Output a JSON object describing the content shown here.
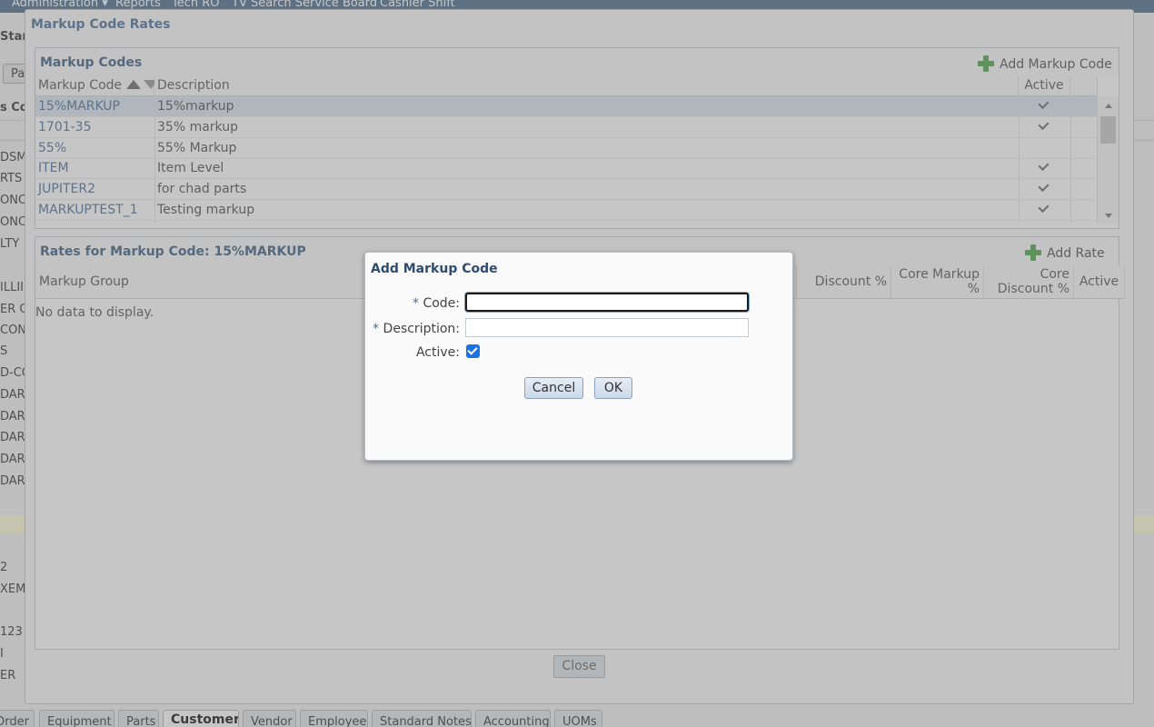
{
  "top_nav": [
    {
      "label": "Administration ▾"
    },
    {
      "label": "Reports"
    },
    {
      "label": "Tech RO"
    },
    {
      "label": "TV Search Service Board"
    },
    {
      "label": "Cashier Shift"
    }
  ],
  "background": {
    "title_fragment": "Star",
    "tab_fragment": "Pa",
    "section_fragment": "s Co",
    "row_fragments": [
      "DSM",
      "RTS",
      "ONC",
      "ONC",
      "LTY",
      "ILLII",
      "ER O",
      "CON",
      "S",
      "D-CO",
      "DARD",
      "DARD",
      "DARD",
      "DARD",
      "DARD",
      "2",
      "XEM",
      "123",
      "I",
      "ER"
    ]
  },
  "bottom_tabs": [
    {
      "label": "Order"
    },
    {
      "label": "Equipment"
    },
    {
      "label": "Parts"
    },
    {
      "label": "Customer"
    },
    {
      "label": "Vendor"
    },
    {
      "label": "Employee"
    },
    {
      "label": "Standard Notes"
    },
    {
      "label": "Accounting"
    },
    {
      "label": "UOMs"
    }
  ],
  "markup_code_rates": {
    "title": "Markup Code Rates",
    "codes_panel": {
      "title": "Markup Codes",
      "add_label": "Add Markup Code",
      "columns": {
        "code": "Markup Code",
        "description": "Description",
        "active": "Active"
      },
      "rows": [
        {
          "code": "15%MARKUP",
          "description": "15%markup",
          "active": true,
          "selected": true
        },
        {
          "code": "1701-35",
          "description": "35% markup",
          "active": true,
          "selected": false
        },
        {
          "code": "55%",
          "description": "55% Markup",
          "active": false,
          "selected": false
        },
        {
          "code": "ITEM",
          "description": "Item Level",
          "active": true,
          "selected": false
        },
        {
          "code": "JUPITER2",
          "description": "for chad parts",
          "active": true,
          "selected": false
        },
        {
          "code": "MARKUPTEST_1",
          "description": "Testing markup",
          "active": true,
          "selected": false
        }
      ]
    },
    "rates_panel": {
      "title": "Rates for Markup Code: 15%MARKUP",
      "add_label": "Add Rate",
      "columns": {
        "group": "Markup Group",
        "discount": "Discount %",
        "core_markup": "Core Markup %",
        "core_discount": "Core Discount %",
        "active": "Active"
      },
      "empty_text": "No data to display."
    },
    "close_label": "Close"
  },
  "add_dialog": {
    "title": "Add Markup Code",
    "required_mark": "*",
    "code_label": "Code:",
    "code_value": "",
    "description_label": "Description:",
    "description_value": "",
    "active_label": "Active:",
    "active_checked": true,
    "cancel_label": "Cancel",
    "ok_label": "OK"
  },
  "colors": {
    "accent": "#1a73e8",
    "title_blue": "#3d5f84",
    "selected_row": "#dbe4ef",
    "add_icon_green": "#4fa84a"
  },
  "icons": [
    "plus-icon",
    "sort-ascending-icon",
    "sort-descending-icon",
    "checkmark-icon",
    "scroll-up-arrow-icon",
    "scroll-down-arrow-icon"
  ]
}
